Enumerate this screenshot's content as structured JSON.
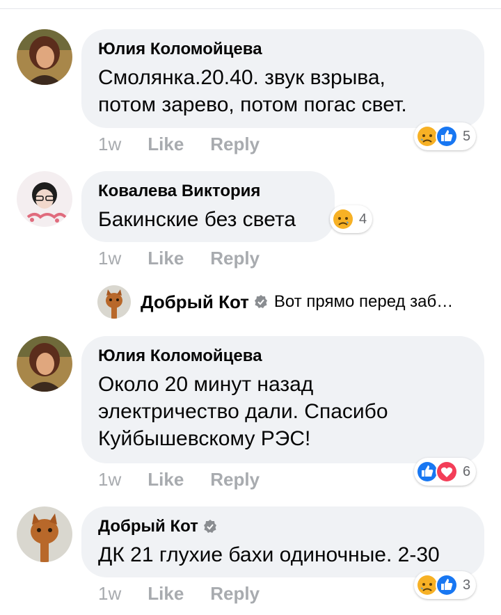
{
  "comments": [
    {
      "author": "Юлия Коломойцева",
      "text_lines": [
        "Смолянка.20.40. звук взрыва,",
        "потом зарево, потом погас свет."
      ],
      "time": "1w",
      "like_label": "Like",
      "reply_label": "Reply",
      "reactions": {
        "icons": [
          "sad-icon",
          "like-icon"
        ],
        "count": "5"
      }
    },
    {
      "author": "Ковалева Виктория",
      "text_lines": [
        "Бакинские без света"
      ],
      "time": "1w",
      "like_label": "Like",
      "reply_label": "Reply",
      "reactions": {
        "icons": [
          "sad-icon"
        ],
        "count": "4"
      }
    },
    {
      "author": "Юлия Коломойцева",
      "text_lines": [
        "Около 20 минут назад",
        "электричество дали. Спасибо",
        "Куйбышевскому РЭС!"
      ],
      "time": "1w",
      "like_label": "Like",
      "reply_label": "Reply",
      "reactions": {
        "icons": [
          "like-icon",
          "love-icon"
        ],
        "count": "6"
      }
    },
    {
      "author": "Добрый Кот",
      "verified": true,
      "text_lines": [
        "ДК 21 глухие бахи одиночные. 2-30"
      ],
      "time": "1w",
      "like_label": "Like",
      "reply_label": "Reply",
      "reactions": {
        "icons": [
          "sad-icon",
          "like-icon"
        ],
        "count": "3"
      }
    }
  ],
  "reply_preview": {
    "author": "Добрый Кот",
    "verified": true,
    "text": "Вот прямо перед заб…"
  },
  "colors": {
    "bubble": "#f0f2f5",
    "action_text": "#a8abaf",
    "like_blue": "#1877f2",
    "love_red": "#f33e58",
    "sad_yellow": "#f7b125"
  }
}
